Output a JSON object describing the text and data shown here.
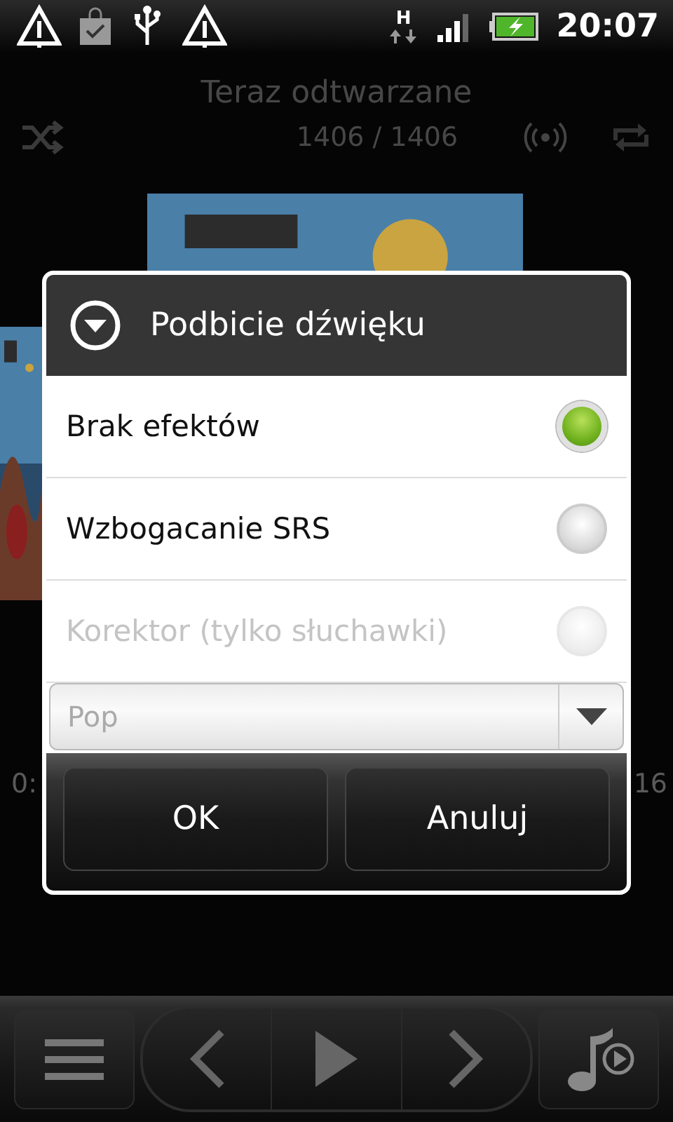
{
  "status_bar": {
    "network": "H",
    "time": "20:07"
  },
  "player": {
    "title": "Teraz odtwarzane",
    "counter": "1406 / 1406",
    "time_elapsed": "0:",
    "time_total": "16"
  },
  "dialog": {
    "title": "Podbicie dźwięku",
    "options": [
      {
        "label": "Brak efektów",
        "selected": true,
        "disabled": false
      },
      {
        "label": "Wzbogacanie SRS",
        "selected": false,
        "disabled": false
      },
      {
        "label": "Korektor (tylko słuchawki)",
        "selected": false,
        "disabled": true
      }
    ],
    "preset": {
      "value": "Pop",
      "disabled": true
    },
    "buttons": [
      "OK",
      "Anuluj"
    ]
  }
}
